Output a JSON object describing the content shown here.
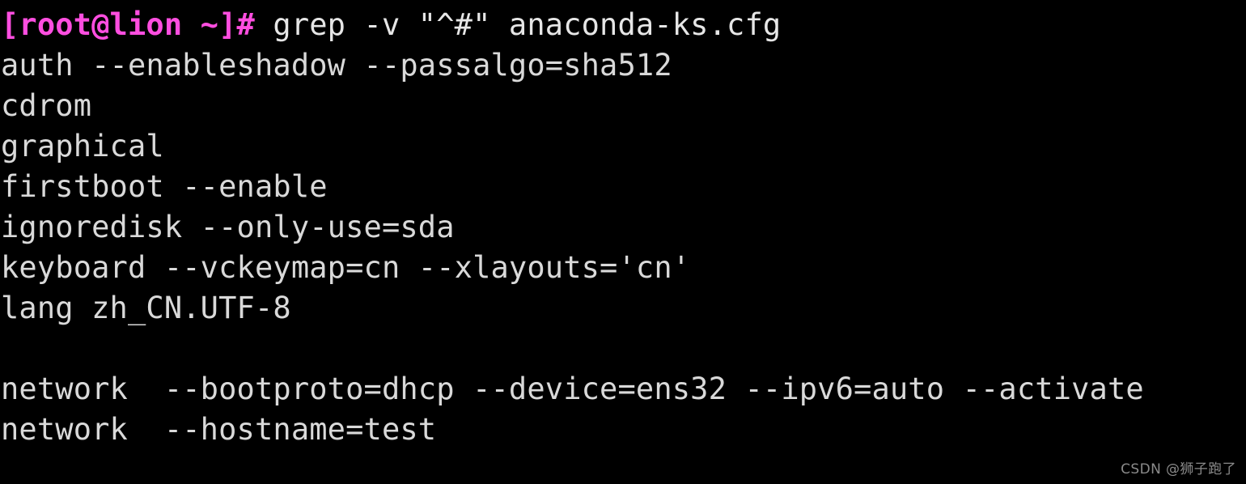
{
  "terminal": {
    "background_color": "#000000",
    "foreground_color": "#d9d9d9",
    "prompt_color": "#ff4ee0",
    "prompt": {
      "text": "[root@lion ~]# ",
      "command": "grep -v \"^#\" anaconda-ks.cfg"
    },
    "output_lines": [
      "auth --enableshadow --passalgo=sha512",
      "cdrom",
      "graphical",
      "firstboot --enable",
      "ignoredisk --only-use=sda",
      "keyboard --vckeymap=cn --xlayouts='cn'",
      "lang zh_CN.UTF-8",
      "",
      "network  --bootproto=dhcp --device=ens32 --ipv6=auto --activate",
      "network  --hostname=test"
    ]
  },
  "watermark": {
    "text": "CSDN @狮子跑了",
    "color": "#8a8a8a"
  }
}
